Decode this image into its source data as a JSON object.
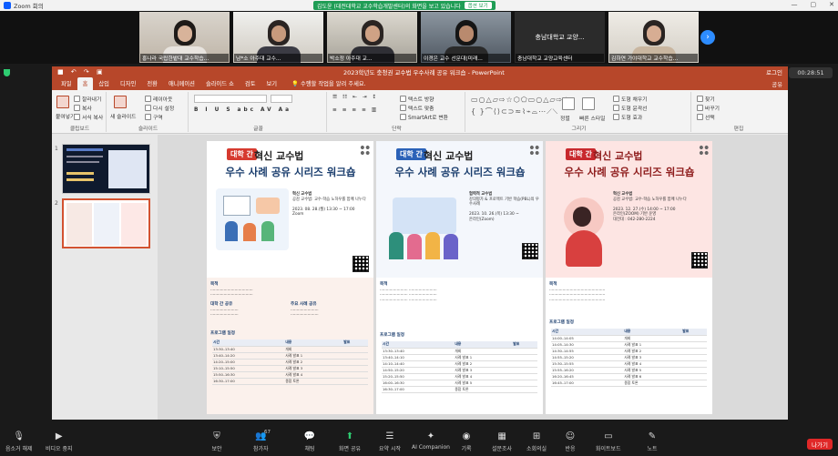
{
  "zoom": {
    "app_title": "Zoom 회의",
    "share_banner": "김도윤 (대전대학교 교수학습개발센터)의 화면을 보고 있습니다",
    "view_options": "옵션 보기",
    "timer": "00:28:51",
    "participants": [
      {
        "name": "홍나라 국립한밭대 교수학습..."
      },
      {
        "name": "남*소 아주대 교수..."
      },
      {
        "name": "박소정 아주대 교..."
      },
      {
        "name": "이경은 교수 선문대(미래..."
      },
      {
        "name": "충남대학교 교양교육센터"
      },
      {
        "name": "김하연 가야대학교 교수학습..."
      }
    ],
    "gallery_text_tile": "충남대학교 교양...",
    "gallery_next": "›",
    "toolbar": [
      {
        "label": "음소거 해제",
        "icon": "mic-off-icon"
      },
      {
        "label": "비디오 중지",
        "icon": "video-icon"
      },
      {
        "label": "보안",
        "icon": "shield-icon"
      },
      {
        "label": "참가자",
        "icon": "participants-icon",
        "count": "67"
      },
      {
        "label": "채팅",
        "icon": "chat-icon"
      },
      {
        "label": "화면 공유",
        "icon": "share-screen-icon"
      },
      {
        "label": "요약 시작",
        "icon": "summary-icon"
      },
      {
        "label": "AI Companion",
        "icon": "ai-companion-icon"
      },
      {
        "label": "기록",
        "icon": "record-icon"
      },
      {
        "label": "설문조사",
        "icon": "poll-icon"
      },
      {
        "label": "소회의실",
        "icon": "breakout-icon"
      },
      {
        "label": "반응",
        "icon": "reaction-icon"
      },
      {
        "label": "화이트보드",
        "icon": "whiteboard-icon"
      },
      {
        "label": "노트",
        "icon": "notes-icon"
      }
    ],
    "leave": "나가기"
  },
  "ppt": {
    "doc_title": "2023학년도 충청권 교수법 우수사례 공유 워크숍 - PowerPoint",
    "login": "로그인",
    "tabs": [
      "파일",
      "홈",
      "삽입",
      "디자인",
      "전환",
      "애니메이션",
      "슬라이드 쇼",
      "검토",
      "보기"
    ],
    "active_tab": "홈",
    "tell_me": "수행할 작업을 알려 주세요.",
    "share": "공유",
    "groups": [
      "클립보드",
      "슬라이드",
      "글꼴",
      "단락",
      "그리기",
      "편집"
    ],
    "clipboard": {
      "paste": "붙여넣기",
      "cut": "잘라내기",
      "copy": "복사",
      "format": "서식 복사"
    },
    "slides_grp": {
      "new": "새 슬라이드",
      "layout": "레이아웃",
      "reset": "다시 설정",
      "section": "구역"
    },
    "paragraph": {
      "direction": "텍스트 방향",
      "align": "텍스트 맞춤",
      "smartart": "SmartArt로 변환"
    },
    "drawing": {
      "arrange": "정렬",
      "quick": "빠른 스타일",
      "fill": "도형 채우기",
      "outline": "도형 윤곽선",
      "effect": "도형 효과"
    },
    "editing": {
      "find": "찾기",
      "replace": "바꾸기",
      "select": "선택"
    },
    "slide_numbers": [
      "1",
      "2"
    ]
  },
  "posters": [
    {
      "tag": "대학 간",
      "title1": "혁신 교수법",
      "title2": "우수 사례 공유 시리즈 워크숍",
      "theme": "혁신 교수법",
      "subtitle": "공감 교수법: 교수·학습 노하우를 함께 나누다",
      "date": "2023. 08. 28.(월) 13:30 ~ 17:00",
      "place": "Zoom",
      "sections": [
        "목적",
        "대학 간 공유",
        "주요 사례 공유",
        "프로그램 일정"
      ]
    },
    {
      "tag": "대학 간",
      "title1": "혁신 교수법",
      "title2": "우수 사례 공유 시리즈 워크숍",
      "theme": "협력적 교수법",
      "subtitle": "강의평가 & 프로젝트 기반 학습(PBL)의 우수사례",
      "date": "2023. 10. 26.(목) 13:30 ~",
      "place": "온라인(Zoom)",
      "sections": [
        "목적",
        "프로그램 일정"
      ]
    },
    {
      "tag": "대학 간",
      "title1": "혁신 교수법",
      "title2": "우수 사례 공유 시리즈 워크숍",
      "theme": "혁신 교수법",
      "subtitle": "공감 교수법: 교수·학습 노하우를 함께 나누다",
      "date": "2023. 12. 27.(수) 14:00 ~ 17:00",
      "place": "온라인(ZOOM) 기반 운영",
      "contact": "대전대 : 042-280-2224",
      "sections": [
        "목적",
        "프로그램 일정"
      ]
    }
  ],
  "colors": {
    "ppt_accent": "#b7472a",
    "zoom_green": "#1f9d55",
    "zoom_blue": "#2d8cff",
    "leave_red": "#e02828"
  }
}
